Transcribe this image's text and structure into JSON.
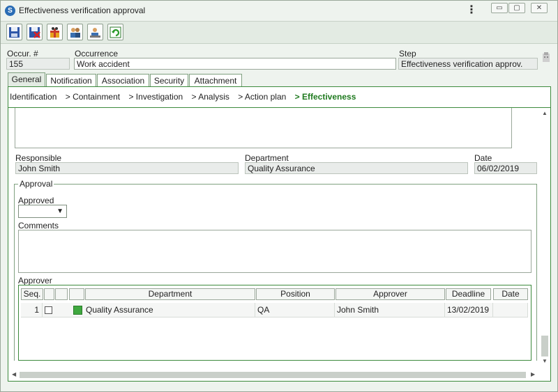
{
  "window": {
    "title": "Effectiveness verification approval"
  },
  "toolbar": {
    "buttons": [
      "save-icon",
      "save-exit-icon",
      "gift-icon",
      "users-icon",
      "user-export-icon",
      "refresh-icon"
    ]
  },
  "header": {
    "occurrence_number_label": "Occur. #",
    "occurrence_number_value": "155",
    "occurrence_label": "Occurrence",
    "occurrence_value": "Work accident",
    "step_label": "Step",
    "step_value": "Effectiveness verification approv."
  },
  "tabs": [
    "General",
    "Notification",
    "Association",
    "Security",
    "Attachment"
  ],
  "breadcrumb": {
    "items": [
      "Identification",
      "> Containment",
      "> Investigation",
      "> Analysis",
      "> Action plan",
      "> Effectiveness"
    ]
  },
  "details": {
    "responsible_label": "Responsible",
    "responsible_value": "John Smith",
    "department_label": "Department",
    "department_value": "Quality Assurance",
    "date_label": "Date",
    "date_value": "06/02/2019"
  },
  "approval": {
    "legend": "Approval",
    "approved_label": "Approved",
    "approved_value": "",
    "comments_label": "Comments",
    "comments_value": "",
    "approver_label": "Approver"
  },
  "grid": {
    "headers": [
      "Seq.",
      "",
      "",
      "",
      "Department",
      "Position",
      "Approver",
      "Deadline",
      "Date"
    ],
    "rows": [
      {
        "seq": "1",
        "department": "Quality Assurance",
        "position": "QA",
        "approver": "John Smith",
        "deadline": "13/02/2019",
        "date": ""
      }
    ]
  },
  "colors": {
    "accent": "#1f7a1f",
    "border": "#3c8a3c"
  }
}
